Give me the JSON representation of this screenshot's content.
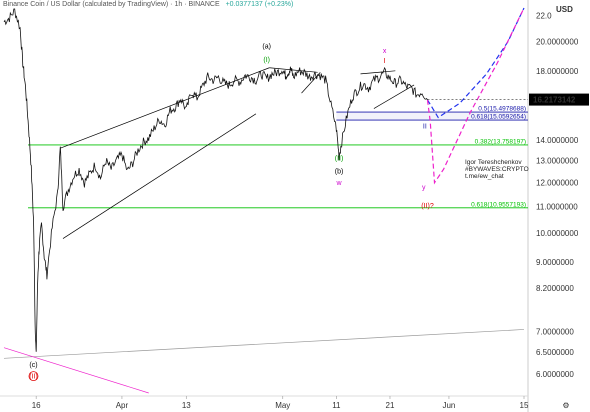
{
  "header": {
    "symbol": "Binance Coin / US Dollar (calculated by TradingView)",
    "interval": "1h",
    "exchange": "BINANCE",
    "change": "+0.0377137 (+0.23%)"
  },
  "currency": "USD",
  "last_price": "16.2173142",
  "author_note": [
    "Igor Tereshchenkov",
    "#BYWAVES:CRYPTO",
    "t.me/ew_chat"
  ],
  "colors": {
    "up": "#26a69a",
    "down": "#ef5350",
    "line": "#000000",
    "fib_green": "#00c000",
    "fib_blue": "#1a1aaa",
    "proj_blue": "#2233ee",
    "proj_pink": "#ee22cc",
    "price_tag": "#000000",
    "wave_green": "#00a000",
    "wave_pink": "#cc00cc",
    "wave_red": "#dd0000"
  },
  "chart_data": {
    "type": "line",
    "title": "Binance Coin / US Dollar (calculated by TradingView)",
    "y_scale": "log",
    "ylim": [
      5.6,
      22.6
    ],
    "y_ticks": [
      {
        "value": 22.0,
        "label": "22.0"
      },
      {
        "value": 20.0,
        "label": "20.0000000"
      },
      {
        "value": 18.0,
        "label": "18.0000000"
      },
      {
        "value": 14.0,
        "label": "14.0000000"
      },
      {
        "value": 13.0,
        "label": "13.0000000"
      },
      {
        "value": 12.0,
        "label": "12.0000000"
      },
      {
        "value": 11.0,
        "label": "11.0000000"
      },
      {
        "value": 10.0,
        "label": "10.0000000"
      },
      {
        "value": 9.0,
        "label": "9.0000000"
      },
      {
        "value": 8.2,
        "label": "8.2000000"
      },
      {
        "value": 7.0,
        "label": "7.0000000"
      },
      {
        "value": 6.5,
        "label": "6.5000000"
      },
      {
        "value": 6.0,
        "label": "6.0000000"
      }
    ],
    "x_ticks": [
      {
        "day": 16,
        "label": "16"
      },
      {
        "day": 32,
        "label": "Apr"
      },
      {
        "day": 44,
        "label": "13"
      },
      {
        "day": 62,
        "label": "May"
      },
      {
        "day": 72,
        "label": "11"
      },
      {
        "day": 82,
        "label": "21"
      },
      {
        "day": 93,
        "label": "Jun"
      },
      {
        "day": 107,
        "label": "15"
      }
    ],
    "x_range": [
      10,
      107
    ],
    "series": [
      {
        "values_x": [
          10,
          11,
          12,
          13,
          13.5,
          14,
          14.5,
          15,
          15.5,
          15.8,
          16,
          16.3,
          16.6,
          17,
          17.5,
          18,
          19,
          20,
          20.5,
          21,
          22,
          23,
          24,
          25,
          26,
          27,
          28,
          29,
          30,
          31,
          32,
          33,
          34,
          35,
          36,
          37,
          38,
          39,
          40,
          41,
          42,
          43,
          44,
          45,
          46,
          47,
          48,
          49,
          50,
          51,
          52,
          53,
          54,
          55,
          56,
          57,
          58,
          59,
          60,
          61,
          62,
          62.5,
          63,
          63.5,
          64,
          65,
          66,
          67,
          68,
          69,
          70,
          71,
          72,
          72.5,
          73,
          74,
          75,
          76,
          77,
          78,
          79,
          80,
          81,
          82,
          83,
          84,
          85,
          86,
          87,
          88,
          89
        ],
        "values_y": [
          21.5,
          21.8,
          22.4,
          21.0,
          18.5,
          17.0,
          15.0,
          13.0,
          10.5,
          7.2,
          6.4,
          8.5,
          9.6,
          10.3,
          9.2,
          8.6,
          10.2,
          11.5,
          13.6,
          11.0,
          11.7,
          12.3,
          12.6,
          12.0,
          12.4,
          12.8,
          12.2,
          13.0,
          12.6,
          13.0,
          13.3,
          12.5,
          12.9,
          13.5,
          13.9,
          14.1,
          14.6,
          15.1,
          14.8,
          15.6,
          15.8,
          16.3,
          15.6,
          16.7,
          16.3,
          17.0,
          17.6,
          17.4,
          17.6,
          17.2,
          17.1,
          17.4,
          17.3,
          17.7,
          17.6,
          17.4,
          17.8,
          17.5,
          17.8,
          17.9,
          18.1,
          17.7,
          17.9,
          18.1,
          17.6,
          18.0,
          17.9,
          17.6,
          17.8,
          17.7,
          17.4,
          15.9,
          14.6,
          13.2,
          13.9,
          15.3,
          16.4,
          16.8,
          17.2,
          16.9,
          17.4,
          17.6,
          17.9,
          17.5,
          17.2,
          17.4,
          17.0,
          16.9,
          16.5,
          16.7,
          16.2
        ]
      }
    ],
    "fib_levels": [
      {
        "value": 15.4978688,
        "label": "0.5(15.4978688)",
        "color": "#1a1aaa"
      },
      {
        "value": 15.0592654,
        "label": "0.618(15.0592654)",
        "color": "#1a1aaa"
      },
      {
        "value": 13.758197,
        "label": "0.382(13.758197)",
        "color": "#00c000"
      },
      {
        "value": 10.9557193,
        "label": "0.618(10.9557193)",
        "color": "#00c000"
      }
    ],
    "wave_labels": [
      {
        "day": 59,
        "price": 19.5,
        "text": "(a)",
        "color": "#000000"
      },
      {
        "day": 59,
        "price": 18.6,
        "text": "(I)",
        "color": "#00a000"
      },
      {
        "day": 72.5,
        "price": 13.0,
        "text": "(II)",
        "color": "#00a000"
      },
      {
        "day": 72.5,
        "price": 12.4,
        "text": "(b)",
        "color": "#000000"
      },
      {
        "day": 72.5,
        "price": 11.9,
        "text": "w",
        "color": "#cc00cc"
      },
      {
        "day": 81,
        "price": 19.2,
        "text": "x",
        "color": "#cc00cc"
      },
      {
        "day": 81,
        "price": 18.5,
        "text": "I",
        "color": "#dd0000"
      },
      {
        "day": 88.5,
        "price": 14.6,
        "text": "II",
        "color": "#1a1aaa"
      },
      {
        "day": 88.3,
        "price": 11.7,
        "text": "y",
        "color": "#cc00cc"
      },
      {
        "day": 89,
        "price": 10.95,
        "text": "(II)?",
        "color": "#dd0000"
      },
      {
        "day": 15.5,
        "price": 6.15,
        "text": "(c)",
        "color": "#000000"
      },
      {
        "day": 15.5,
        "price": 5.9,
        "text": "(II)",
        "color": "#dd0000"
      }
    ],
    "projections": [
      {
        "name": "blue",
        "x": [
          89,
          91,
          95,
          100,
          104,
          107
        ],
        "y": [
          16.2,
          15.2,
          16.0,
          17.8,
          20.0,
          22.6
        ],
        "color": "#2233ee"
      },
      {
        "name": "pink",
        "x": [
          89,
          89.5,
          90.3,
          92,
          97,
          102,
          107
        ],
        "y": [
          16.2,
          15.0,
          12.0,
          12.6,
          15.5,
          18.5,
          22.6
        ],
        "color": "#ee22cc"
      }
    ],
    "trendlines": [
      {
        "x": [
          20.5,
          59.5
        ],
        "y": [
          13.6,
          18.2
        ],
        "color": "#000000"
      },
      {
        "x": [
          21,
          57
        ],
        "y": [
          9.8,
          15.4
        ],
        "color": "#000000"
      },
      {
        "x": [
          59.5,
          68.5
        ],
        "y": [
          18.2,
          17.9
        ],
        "color": "#000000"
      },
      {
        "x": [
          65.5,
          69
        ],
        "y": [
          16.6,
          17.9
        ],
        "color": "#000000"
      },
      {
        "x": [
          76.5,
          83
        ],
        "y": [
          17.8,
          18.0
        ],
        "color": "#000000"
      },
      {
        "x": [
          79,
          86.5
        ],
        "y": [
          15.7,
          17.1
        ],
        "color": "#000000"
      },
      {
        "x": [
          10,
          107
        ],
        "y": [
          6.35,
          7.05
        ],
        "color": "#999999"
      },
      {
        "x": [
          10,
          37
        ],
        "y": [
          6.6,
          5.6
        ],
        "color": "#ee22cc"
      }
    ]
  }
}
